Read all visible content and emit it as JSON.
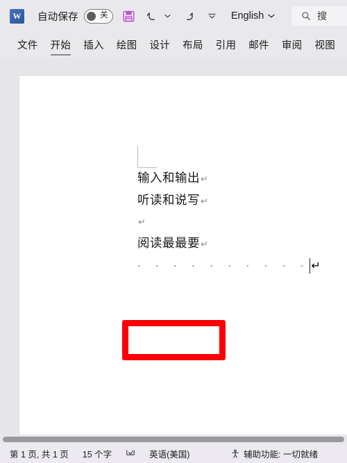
{
  "app": {
    "logo_letter": "W",
    "logo_name": "word-logo"
  },
  "titlebar": {
    "autosave_label": "自动保存",
    "autosave_state": "关",
    "save_icon": "save-icon",
    "undo_icon": "undo-icon",
    "undo_chevron_icon": "chevron-down-icon",
    "redo_icon": "redo-icon",
    "customize_icon": "customize-quick-access-icon",
    "language": "English",
    "language_chevron_icon": "chevron-down-icon"
  },
  "search": {
    "icon": "search-icon",
    "placeholder": "搜"
  },
  "ribbon": {
    "tabs": [
      {
        "label": "文件",
        "active": false
      },
      {
        "label": "开始",
        "active": true
      },
      {
        "label": "插入",
        "active": false
      },
      {
        "label": "绘图",
        "active": false
      },
      {
        "label": "设计",
        "active": false
      },
      {
        "label": "布局",
        "active": false
      },
      {
        "label": "引用",
        "active": false
      },
      {
        "label": "邮件",
        "active": false
      },
      {
        "label": "审阅",
        "active": false
      },
      {
        "label": "视图",
        "active": false
      }
    ]
  },
  "document": {
    "lines": [
      {
        "text": "输入和输出",
        "mark": "↵"
      },
      {
        "text": "听读和说写",
        "mark": "↵"
      },
      {
        "text": "",
        "mark": "↵"
      },
      {
        "text": "阅读最最要",
        "mark": "↵"
      }
    ],
    "leader_line": {
      "dots": "· · · · · · · · · ·",
      "mark": "↵"
    },
    "annotation_color": "#fb0007"
  },
  "statusbar": {
    "page_info": "第 1 页, 共 1 页",
    "word_count": "15 个字",
    "proofing_icon": "proofing-errors-icon",
    "language": "英语(美国)",
    "accessibility_icon": "accessibility-icon",
    "accessibility": "辅助功能: 一切就绪"
  }
}
